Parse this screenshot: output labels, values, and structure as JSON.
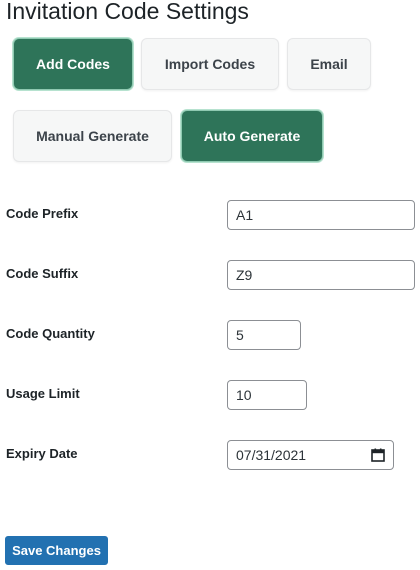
{
  "page": {
    "title": "Invitation Code Settings"
  },
  "tabs_row1": {
    "add_codes": "Add Codes",
    "import_codes": "Import Codes",
    "email": "Email"
  },
  "tabs_row2": {
    "manual_generate": "Manual Generate",
    "auto_generate": "Auto Generate"
  },
  "fields": {
    "code_prefix": {
      "label": "Code Prefix",
      "value": "A1"
    },
    "code_suffix": {
      "label": "Code Suffix",
      "value": "Z9"
    },
    "code_quantity": {
      "label": "Code Quantity",
      "value": "5"
    },
    "usage_limit": {
      "label": "Usage Limit",
      "value": "10"
    },
    "expiry_date": {
      "label": "Expiry Date",
      "value": "07/31/2021",
      "icon": "calendar-icon"
    }
  },
  "actions": {
    "save_label": "Save Changes"
  },
  "colors": {
    "active_tab": "#2e7459",
    "inactive_tab": "#f6f7f7",
    "primary_button": "#2271b1"
  }
}
